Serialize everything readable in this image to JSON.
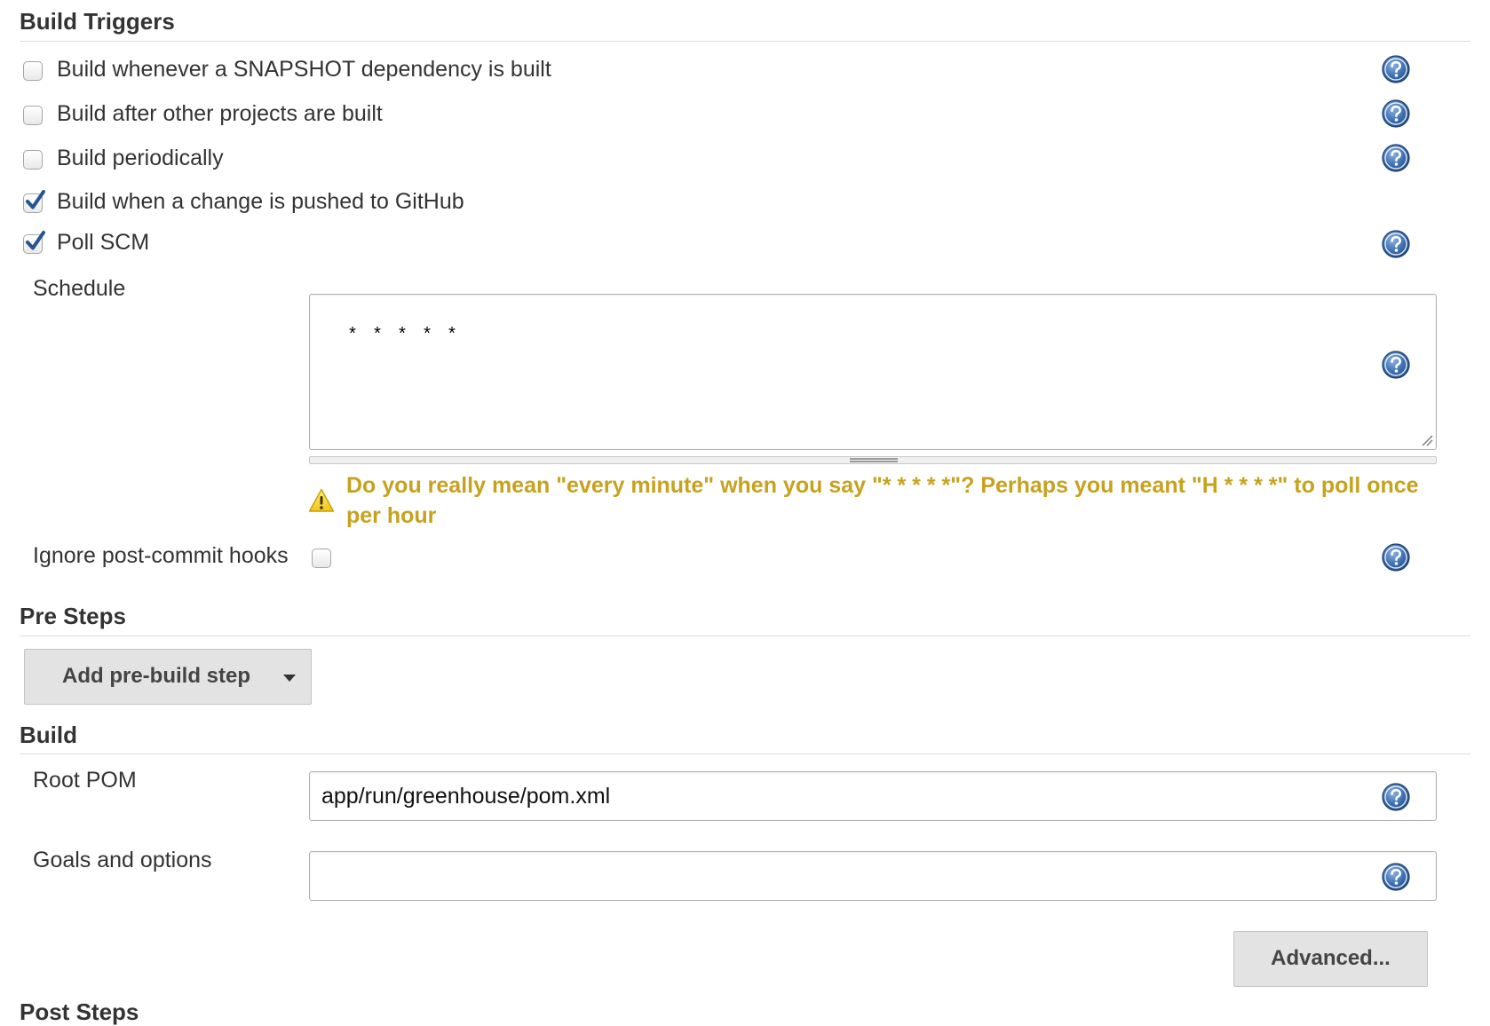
{
  "sections": {
    "build_triggers": "Build Triggers",
    "pre_steps": "Pre Steps",
    "build": "Build",
    "post_steps": "Post Steps"
  },
  "triggers": [
    {
      "label": "Build whenever a SNAPSHOT dependency is built",
      "checked": false
    },
    {
      "label": "Build after other projects are built",
      "checked": false
    },
    {
      "label": "Build periodically",
      "checked": false
    },
    {
      "label": "Build when a change is pushed to GitHub",
      "checked": true
    },
    {
      "label": "Poll SCM",
      "checked": true
    }
  ],
  "poll_scm": {
    "schedule_label": "Schedule",
    "schedule_value": "* * * * *",
    "warning": "Do you really mean \"every minute\" when you say \"* * * * *\"? Perhaps you meant \"H * * * *\" to poll once per hour",
    "ignore_hooks_label": "Ignore post-commit hooks",
    "ignore_hooks_checked": false
  },
  "pre_steps": {
    "add_button": "Add pre-build step"
  },
  "build": {
    "root_pom_label": "Root POM",
    "root_pom_value": "app/run/greenhouse/pom.xml",
    "goals_label": "Goals and options",
    "goals_value": "",
    "advanced_button": "Advanced..."
  },
  "icons": {
    "help": "help-icon",
    "warning": "warning-icon",
    "dropdown": "caret-down-icon"
  },
  "colors": {
    "warning_text": "#c6a21e",
    "help_icon": "#2f5e9c",
    "checkmark": "#2a5a96"
  }
}
